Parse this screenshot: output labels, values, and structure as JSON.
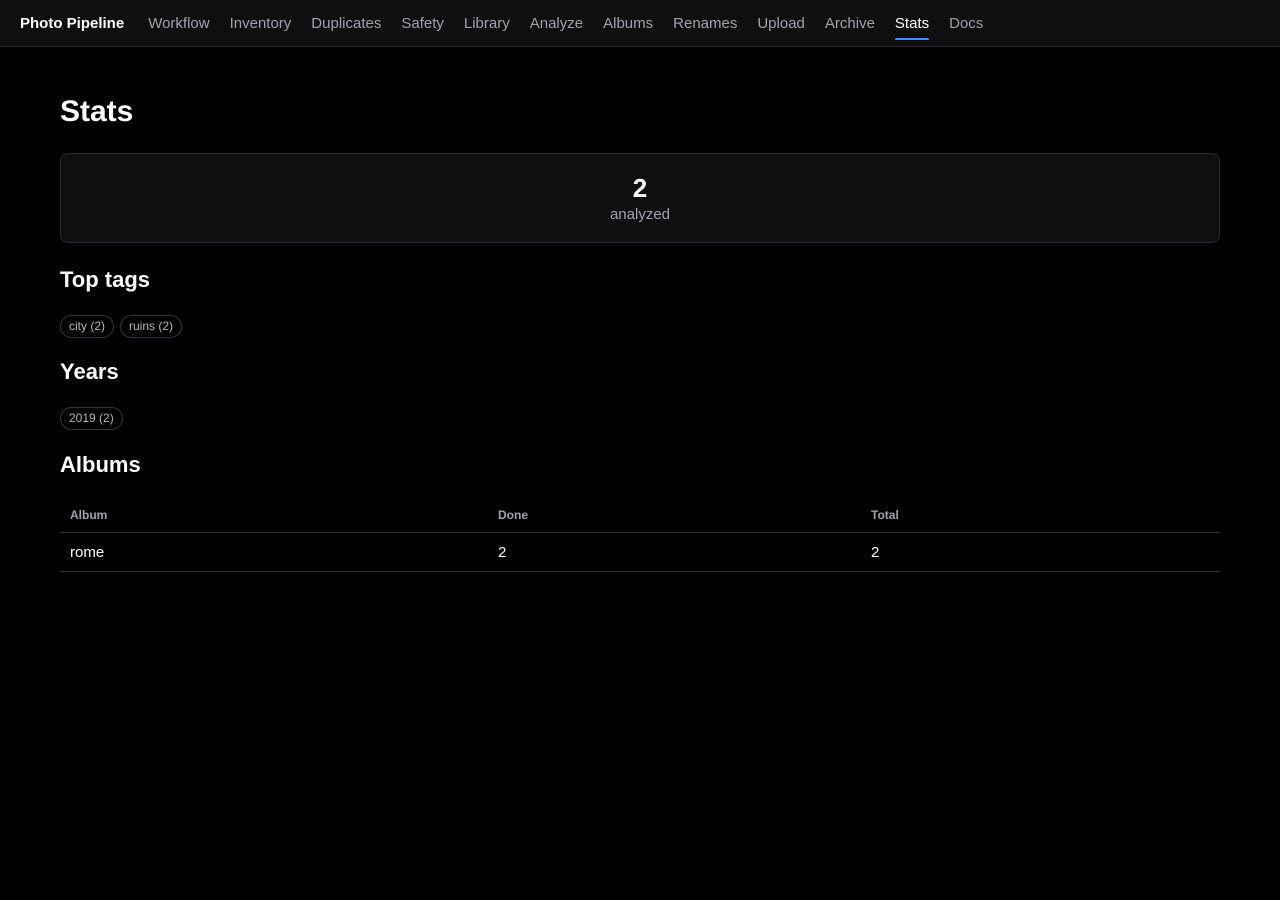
{
  "nav": {
    "brand": "Photo Pipeline",
    "links": [
      {
        "label": "Workflow"
      },
      {
        "label": "Inventory"
      },
      {
        "label": "Duplicates"
      },
      {
        "label": "Safety"
      },
      {
        "label": "Library"
      },
      {
        "label": "Analyze"
      },
      {
        "label": "Albums"
      },
      {
        "label": "Renames"
      },
      {
        "label": "Upload"
      },
      {
        "label": "Archive"
      },
      {
        "label": "Stats",
        "active": true
      },
      {
        "label": "Docs"
      }
    ],
    "active_accent": "#4a8cff"
  },
  "page": {
    "title": "Stats"
  },
  "summary": {
    "value": "2",
    "label": "analyzed"
  },
  "top_tags": {
    "title": "Top tags",
    "items": [
      "city (2)",
      "ruins (2)"
    ]
  },
  "years": {
    "title": "Years",
    "items": [
      "2019 (2)"
    ]
  },
  "albums": {
    "title": "Albums",
    "columns": [
      "Album",
      "Done",
      "Total"
    ],
    "rows": [
      {
        "album": "rome",
        "done": "2",
        "total": "2"
      }
    ]
  }
}
